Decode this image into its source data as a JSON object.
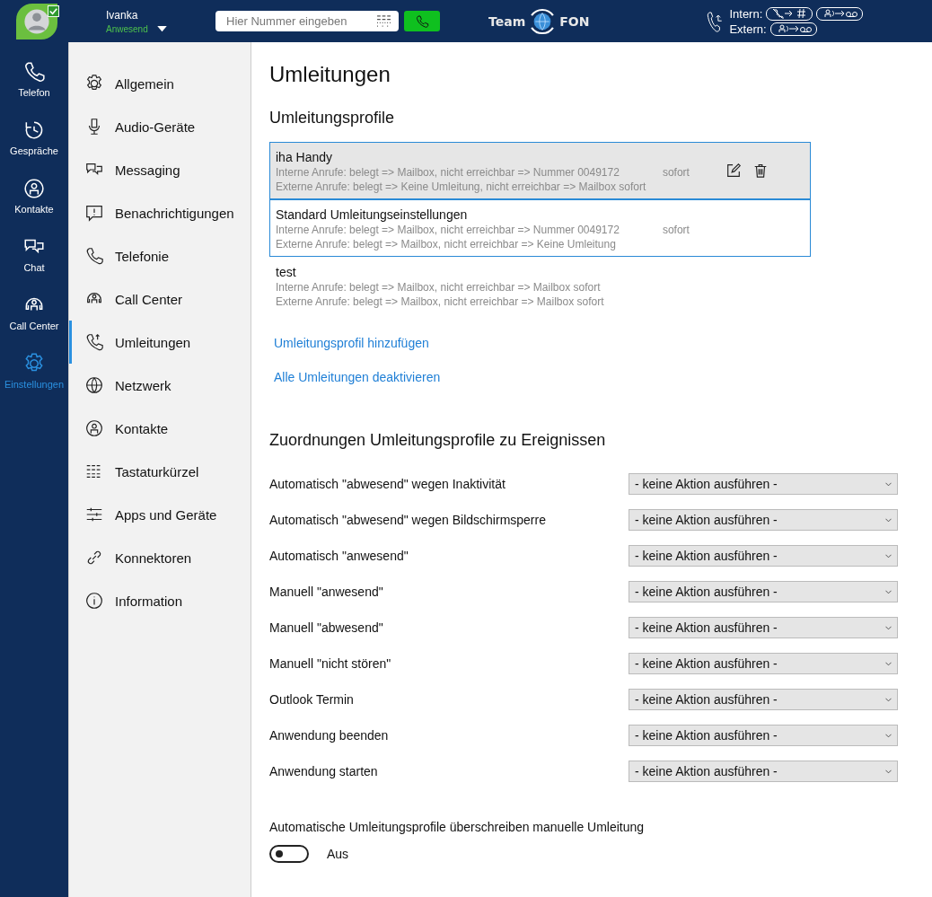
{
  "user": {
    "name": "Ivanka",
    "status": "Anwesend"
  },
  "dial": {
    "placeholder": "Hier Nummer eingeben"
  },
  "logo": {
    "left": "Team",
    "right": "FON"
  },
  "forwarding": [
    {
      "label": "Intern:",
      "rules": [
        {
          "kind": "keypad"
        },
        {
          "kind": "mailbox"
        }
      ]
    },
    {
      "label": "Extern:",
      "rules": [
        {
          "kind": "mailbox"
        }
      ]
    }
  ],
  "rail": [
    {
      "label": "Telefon",
      "selected": false
    },
    {
      "label": "Gespräche",
      "selected": false
    },
    {
      "label": "Kontakte",
      "selected": false
    },
    {
      "label": "Chat",
      "selected": false
    },
    {
      "label": "Call Center",
      "selected": false
    },
    {
      "label": "Einstellungen",
      "selected": true
    }
  ],
  "settings_nav": [
    {
      "label": "Allgemein",
      "selected": false
    },
    {
      "label": "Audio-Geräte",
      "selected": false
    },
    {
      "label": "Messaging",
      "selected": false
    },
    {
      "label": "Benachrichtigungen",
      "selected": false
    },
    {
      "label": "Telefonie",
      "selected": false
    },
    {
      "label": "Call Center",
      "selected": false
    },
    {
      "label": "Umleitungen",
      "selected": true
    },
    {
      "label": "Netzwerk",
      "selected": false
    },
    {
      "label": "Kontakte",
      "selected": false
    },
    {
      "label": "Tastaturkürzel",
      "selected": false
    },
    {
      "label": "Apps und Geräte",
      "selected": false
    },
    {
      "label": "Konnektoren",
      "selected": false
    },
    {
      "label": "Information",
      "selected": false
    }
  ],
  "title": "Umleitungen",
  "profiles_heading": "Umleitungsprofile",
  "profiles": [
    {
      "name": "iha Handy",
      "intern": "Interne Anrufe: belegt => Mailbox, nicht erreichbar => Nummer 0049172",
      "intern_timing": "sofort",
      "extern": "Externe Anrufe: belegt => Keine Umleitung, nicht erreichbar => Mailbox sofort",
      "selected": true,
      "hovered": true
    },
    {
      "name": "Standard Umleitungseinstellungen",
      "intern": "Interne Anrufe: belegt => Mailbox, nicht erreichbar => Nummer 0049172",
      "intern_timing": "sofort",
      "extern": "Externe Anrufe: belegt => Mailbox, nicht erreichbar => Keine Umleitung",
      "selected": true,
      "hovered": false
    },
    {
      "name": "test",
      "intern": "Interne Anrufe: belegt => Mailbox, nicht erreichbar => Mailbox sofort",
      "extern": "Externe Anrufe: belegt => Mailbox, nicht erreichbar => Mailbox sofort",
      "selected": false,
      "hovered": false
    }
  ],
  "links": [
    "Umleitungsprofil hinzufügen",
    "Alle Umleitungen deaktivieren"
  ],
  "mapping_heading": "Zuordnungen Umleitungsprofile zu Ereignissen",
  "mappings": [
    {
      "event": "Automatisch \"abwesend\" wegen Inaktivität",
      "value": "- keine Aktion ausführen -"
    },
    {
      "event": "Automatisch \"abwesend\" wegen Bildschirmsperre",
      "value": "- keine Aktion ausführen -"
    },
    {
      "event": "Automatisch \"anwesend\"",
      "value": "- keine Aktion ausführen -"
    },
    {
      "event": "Manuell \"anwesend\"",
      "value": "- keine Aktion ausführen -"
    },
    {
      "event": "Manuell \"abwesend\"",
      "value": "- keine Aktion ausführen -"
    },
    {
      "event": "Manuell \"nicht stören\"",
      "value": "- keine Aktion ausführen -"
    },
    {
      "event": "Outlook Termin",
      "value": "- keine Aktion ausführen -"
    },
    {
      "event": "Anwendung beenden",
      "value": "- keine Aktion ausführen -"
    },
    {
      "event": "Anwendung starten",
      "value": "- keine Aktion ausführen -"
    }
  ],
  "override": {
    "label": "Automatische Umleitungsprofile überschreiben manuelle Umleitung",
    "on": false,
    "state_label": "Aus"
  }
}
